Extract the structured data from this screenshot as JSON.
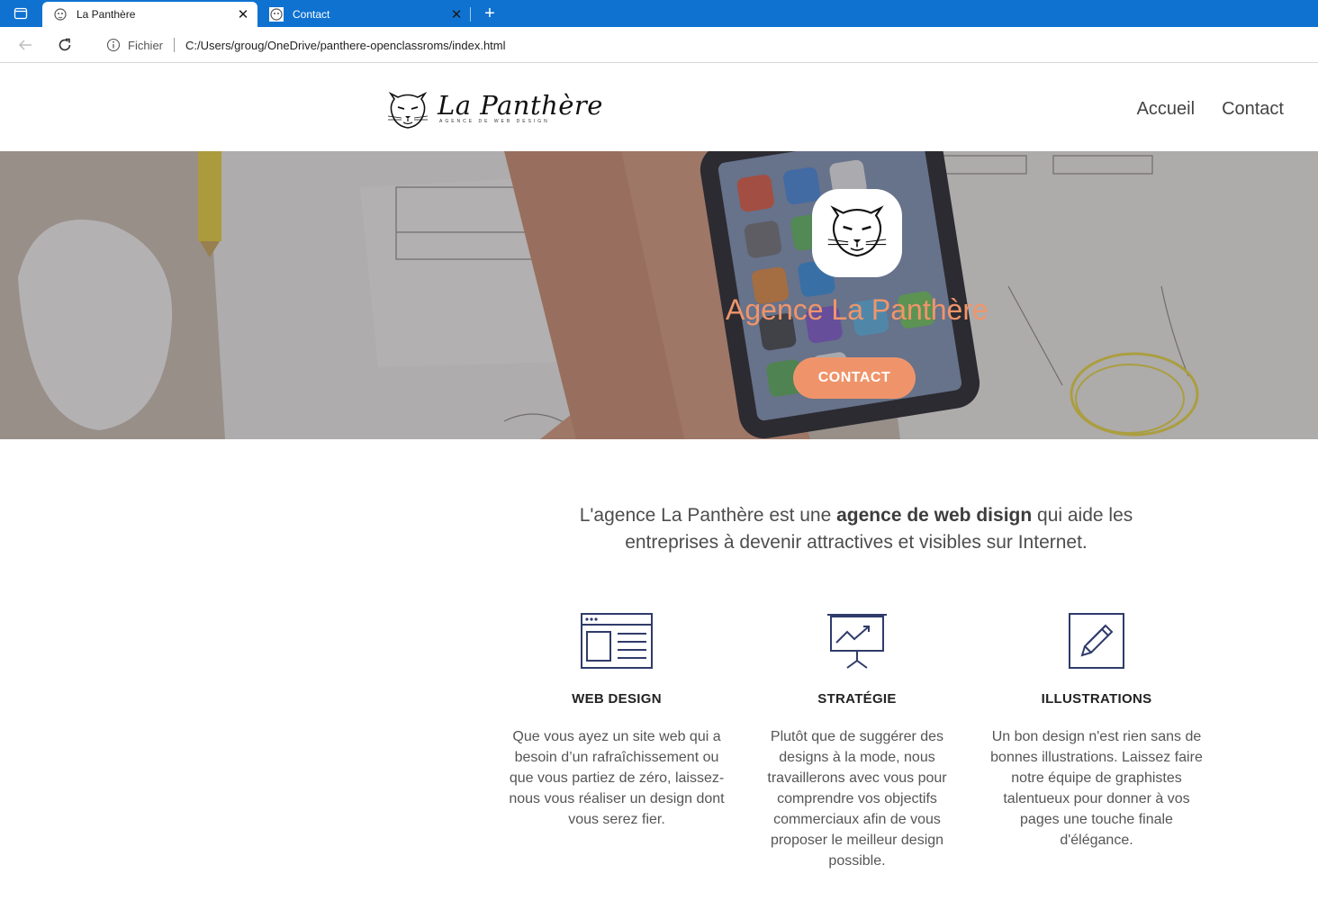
{
  "browser": {
    "tabs": [
      {
        "title": "La Panthère",
        "icon": "panther-favicon",
        "active": true
      },
      {
        "title": "Contact",
        "icon": "panther-favicon",
        "active": false
      }
    ],
    "address": {
      "scheme_label": "Fichier",
      "url": "C:/Users/groug/OneDrive/panthere-openclassroms/index.html"
    },
    "accent_color": "#0f72d0"
  },
  "site": {
    "logo": {
      "name": "La Panthère",
      "tagline": "AGENCE DE WEB DESIGN",
      "icon": "panther-icon"
    },
    "nav": [
      {
        "label": "Accueil"
      },
      {
        "label": "Contact"
      }
    ],
    "hero": {
      "title": "Agence La Panthère",
      "button": "CONTACT",
      "accent_color": "#ef946a"
    },
    "intro": {
      "before": "L'agence La Panthère est une ",
      "bold": "agence de web disign",
      "after": " qui aide les entreprises à devenir attractives et visibles sur Internet."
    },
    "services": [
      {
        "icon": "browser-window-icon",
        "title": "WEB DESIGN",
        "text": "Que vous ayez un site web qui a besoin d’un rafraîchissement ou que vous partiez de zéro, laissez-nous vous réaliser un design dont vous serez fier."
      },
      {
        "icon": "presentation-chart-icon",
        "title": "STRATÉGIE",
        "text": "Plutôt que de suggérer des designs à la mode, nous travaillerons avec vous pour comprendre vos objectifs commerciaux afin de vous proposer le meilleur design possible."
      },
      {
        "icon": "pencil-edit-icon",
        "title": "ILLUSTRATIONS",
        "text": "Un bon design n'est rien sans de bonnes illustrations. Laissez faire notre équipe de graphistes talentueux pour donner à vos pages une touche finale d'élégance."
      }
    ]
  }
}
